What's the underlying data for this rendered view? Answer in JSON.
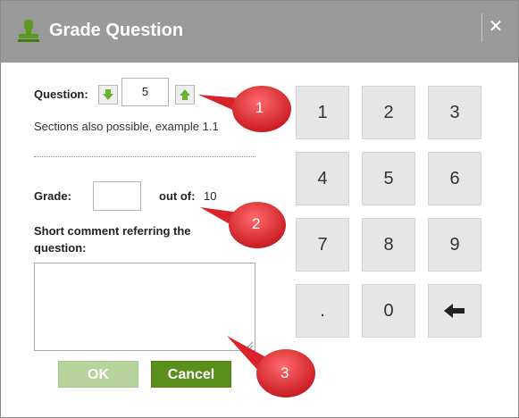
{
  "dialog": {
    "title": "Grade Question",
    "close_glyph": "✕",
    "title_icon": "stamp-icon"
  },
  "question": {
    "label": "Question:",
    "value": "5",
    "hint": "Sections also possible, example 1.1",
    "decrement_icon": "arrow-down-icon",
    "increment_icon": "arrow-up-icon"
  },
  "grade": {
    "label": "Grade:",
    "value": "",
    "out_of_label": "out of:",
    "out_of_value": "10"
  },
  "comment": {
    "label": "Short comment referring the question:",
    "value": ""
  },
  "buttons": {
    "ok": "OK",
    "cancel": "Cancel"
  },
  "keypad": {
    "keys": [
      "1",
      "2",
      "3",
      "4",
      "5",
      "6",
      "7",
      "8",
      "9",
      ".",
      "0"
    ],
    "backspace_icon": "backspace-arrow-icon"
  },
  "callouts": [
    "1",
    "2",
    "3"
  ],
  "colors": {
    "titlebar": "#9a9a9a",
    "ok_button": "#b6d49c",
    "cancel_button": "#5b8f1c",
    "arrow_green": "#6ab42d",
    "callout_red": "#e8272e",
    "key_bg": "#e6e6e6"
  }
}
